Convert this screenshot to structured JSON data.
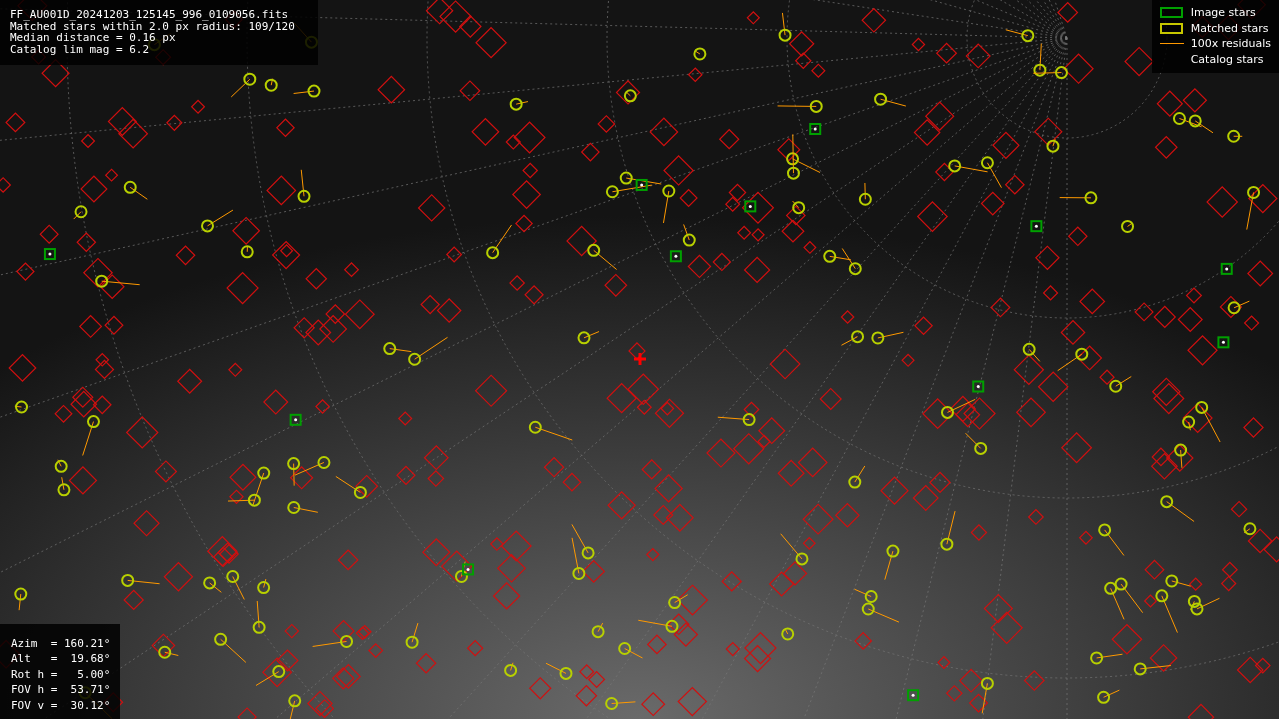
{
  "info_lines": [
    "FF_AU001D_20241203_125145_996_0109056.fits",
    "Matched stars within 2.0 px radius: 109/120",
    "Median distance = 0.16 px",
    "Catalog lim mag = 6.2"
  ],
  "legend": [
    {
      "kind": "box",
      "label": "Image stars",
      "color": "#00a000"
    },
    {
      "kind": "box",
      "label": "Matched stars",
      "color": "#c8c800"
    },
    {
      "kind": "line",
      "label": "100x residuals",
      "color": "#ff9900"
    },
    {
      "kind": "none",
      "label": "Catalog stars"
    }
  ],
  "pointing_lines": [
    "Azim  = 160.21°",
    "Alt   =  19.68°",
    "Rot h =   5.00°",
    "FOV h =  53.71°",
    "FOV v =  30.12°"
  ]
}
